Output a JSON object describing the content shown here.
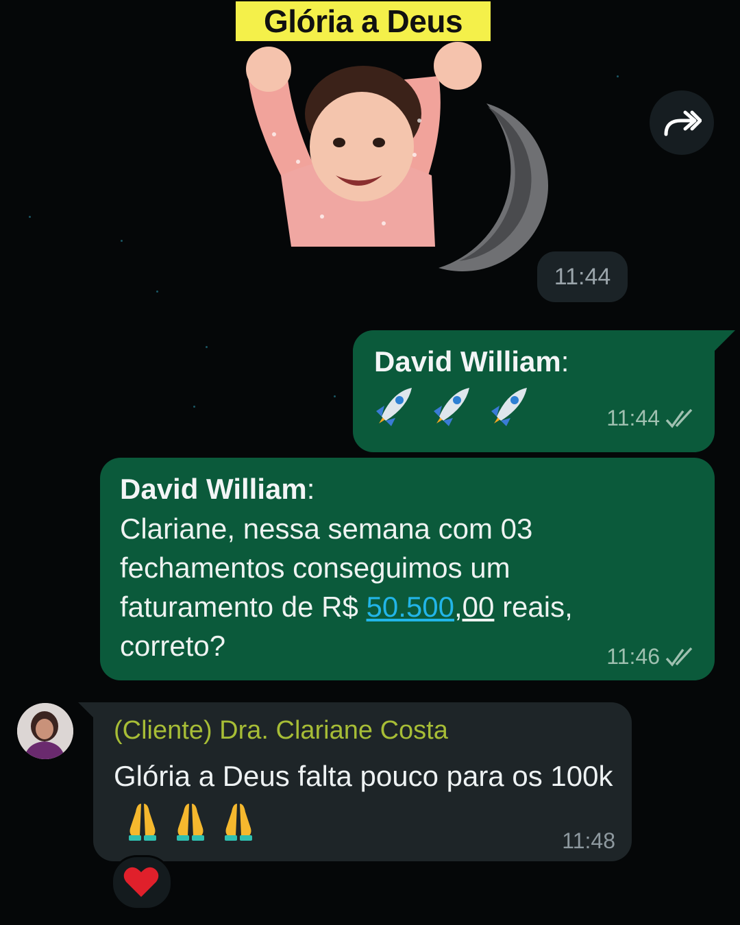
{
  "sticker": {
    "caption": "Glória a Deus",
    "time": "11:44"
  },
  "messages": [
    {
      "direction": "outgoing",
      "sender": "David William",
      "sender_suffix": ":",
      "emoji": [
        "rocket",
        "rocket",
        "rocket"
      ],
      "time": "11:44",
      "status": "double-check"
    },
    {
      "direction": "outgoing",
      "sender": "David William",
      "sender_suffix": ":",
      "text_before_link": "Clariane, nessa semana com 03 fechamentos conseguimos um faturamento de R$ ",
      "link_text": "50.500",
      "text_underlined": ",00",
      "text_after_link": " reais, correto?",
      "time": "11:46",
      "status": "double-check"
    },
    {
      "direction": "incoming",
      "sender": "(Cliente) Dra. Clariane Costa",
      "text": "Glória a Deus falta pouco para os 100k",
      "emoji": [
        "folded-hands",
        "folded-hands",
        "folded-hands"
      ],
      "time": "11:48",
      "reaction": "red-heart"
    }
  ],
  "icons": {
    "forward": "forward-icon",
    "read_receipt": "double-check-icon"
  },
  "colors": {
    "background": "#050708",
    "outgoing_bubble": "#0b5a3b",
    "incoming_bubble": "#1e2528",
    "incoming_sender": "#a7bd36",
    "link": "#22b5e8",
    "sticker_caption_bg": "#f4f04a"
  }
}
